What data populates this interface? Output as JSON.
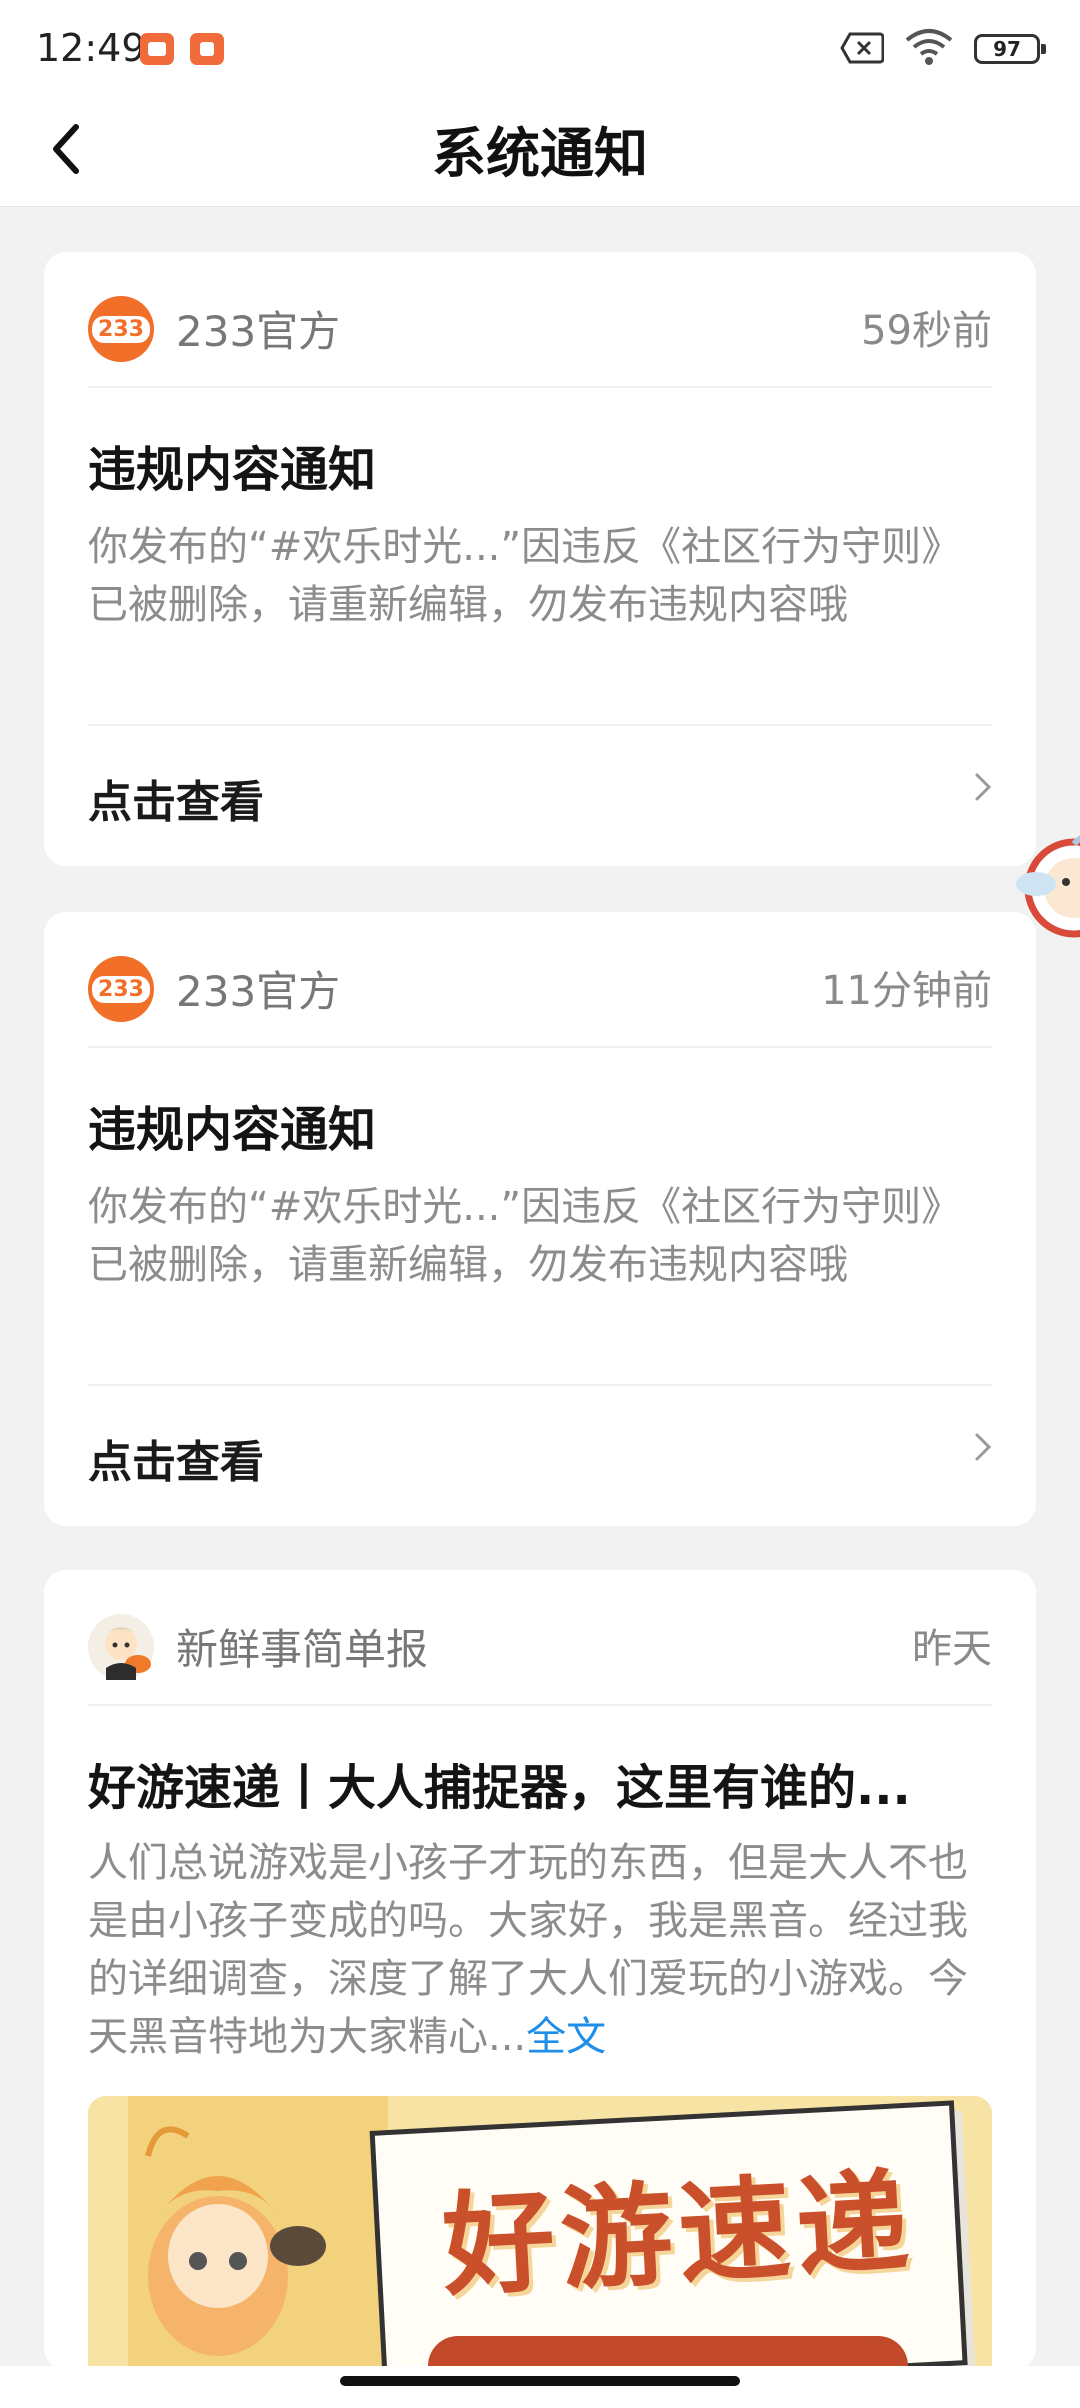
{
  "status_bar": {
    "time": "12:49",
    "battery": "97",
    "icons": [
      "video-app-icon",
      "store-app-icon",
      "no-sim-icon",
      "wifi-icon",
      "battery-icon"
    ]
  },
  "header": {
    "title": "系统通知",
    "back_icon": "chevron-left-icon"
  },
  "notifications": [
    {
      "sender": "233官方",
      "avatar_text": "233",
      "time": "59秒前",
      "title": "违规内容通知",
      "body": "你发布的“#欢乐时光...”因违反《社区行为守则》已被删除，请重新编辑，勿发布违规内容哦",
      "action": "点击查看"
    },
    {
      "sender": "233官方",
      "avatar_text": "233",
      "time": "11分钟前",
      "title": "违规内容通知",
      "body": "你发布的“#欢乐时光...”因违反《社区行为守则》已被删除，请重新编辑，勿发布违规内容哦",
      "action": "点击查看"
    },
    {
      "sender": "新鲜事简单报",
      "time": "昨天",
      "title": "好游速递丨大人捕捉器，这里有谁的...",
      "body": "人们总说游戏是小孩子才玩的东西，但是大人不也是由小孩子变成的吗。大家好，我是黑音。经过我的详细调查，深度了解了大人们爱玩的小游戏。今天黑音特地为大家精心...",
      "more_link": "全文",
      "banner_text": "好游速递"
    }
  ],
  "colors": {
    "accent_orange": "#f26f2a",
    "link_blue": "#1e8ee8",
    "background": "#f2f2f2"
  }
}
